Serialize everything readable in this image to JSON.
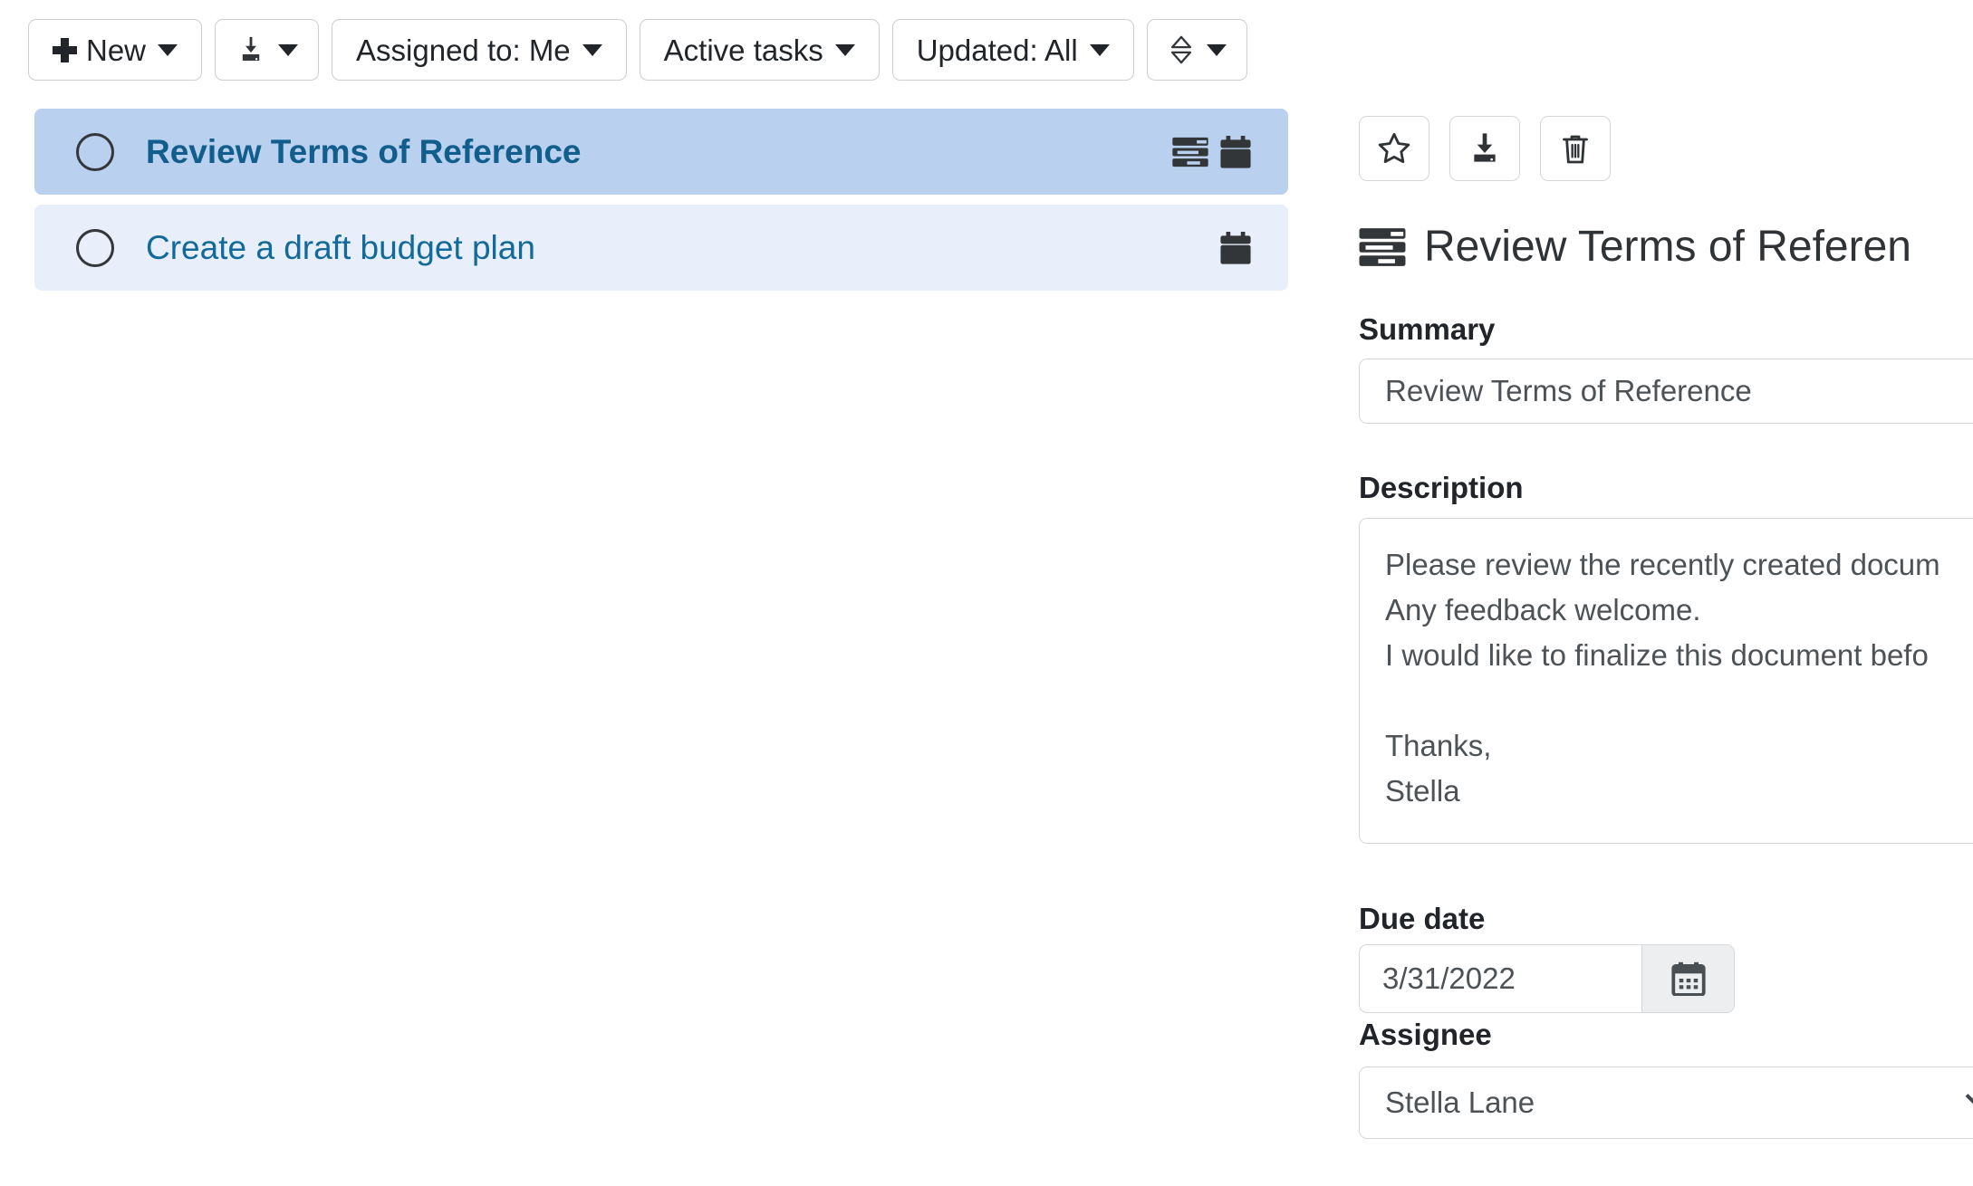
{
  "toolbar": {
    "new_label": "New",
    "export_label": "",
    "assigned_label": "Assigned to: Me",
    "filter_label": "Active tasks",
    "updated_label": "Updated: All",
    "sort_label": ""
  },
  "task_list": {
    "items": [
      {
        "title": "Review Terms of Reference",
        "selected": true,
        "has_description_icon": true,
        "has_due_date_icon": true
      },
      {
        "title": "Create a draft budget plan",
        "selected": false,
        "has_description_icon": false,
        "has_due_date_icon": true
      }
    ]
  },
  "detail": {
    "title": "Review Terms of Referen",
    "summary_label": "Summary",
    "summary_value": "Review Terms of Reference",
    "description_label": "Description",
    "description_value": "Please review the recently created docum\nAny feedback welcome.\nI would like to finalize this document befo\n\nThanks,\nStella",
    "due_date_label": "Due date",
    "due_date_value": "3/31/2022",
    "assignee_label": "Assignee",
    "assignee_value": "Stella Lane"
  },
  "colors": {
    "selected_row_bg": "#b9d0ee",
    "row_bg": "#e8effa",
    "link_text": "#126a9c",
    "icon_dark": "#333638"
  }
}
